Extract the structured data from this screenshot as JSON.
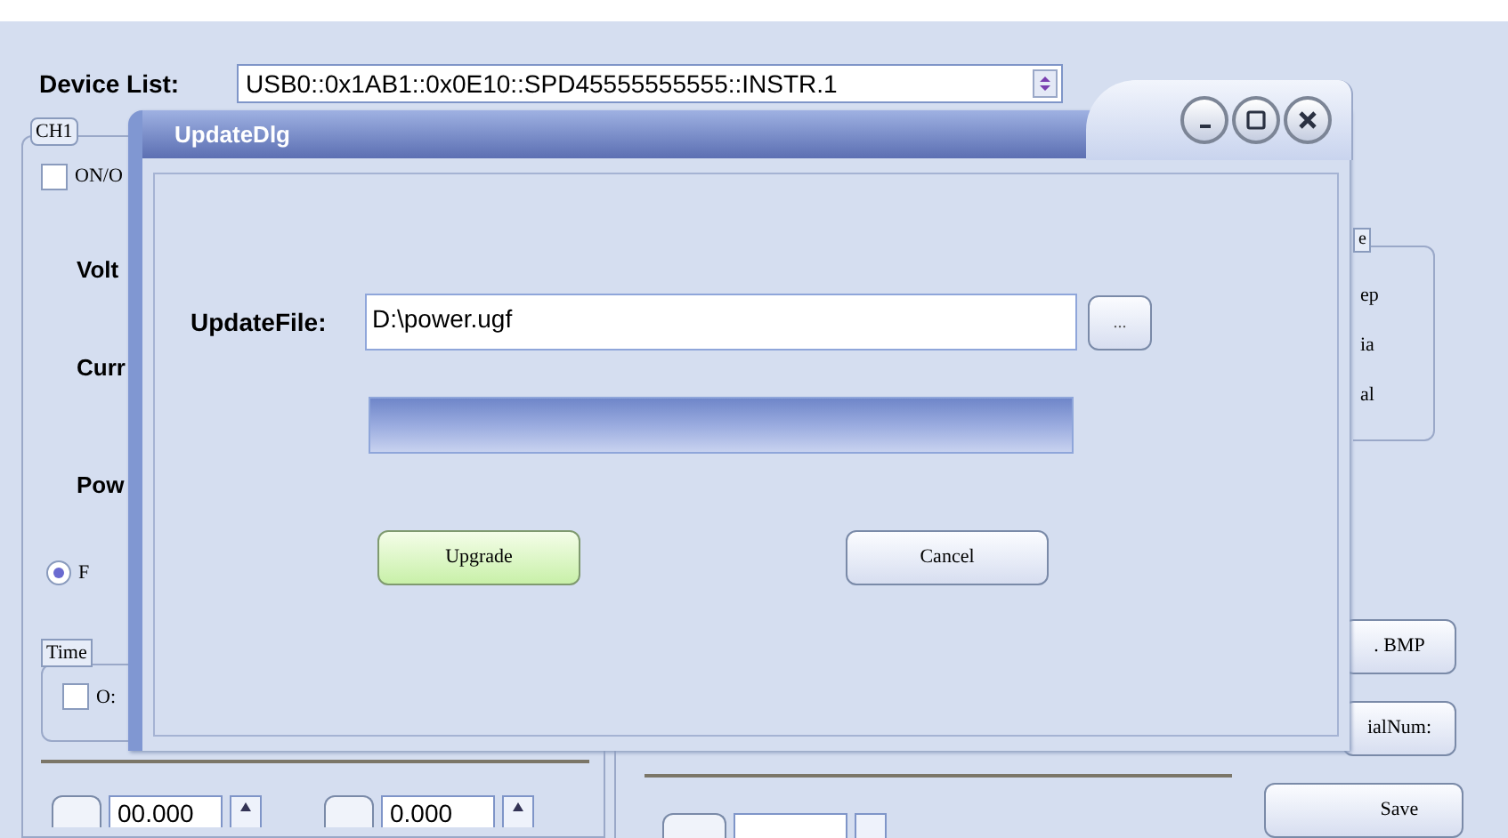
{
  "device_list": {
    "label": "Device List:",
    "value": "USB0::0x1AB1::0x0E10::SPD45555555555::INSTR.1"
  },
  "channel_panel": {
    "tab": "CH1",
    "output_checkbox": {
      "label": "ON/O",
      "checked": false
    },
    "labels": [
      "Volt",
      "Curr",
      "Pow"
    ],
    "mode_radio": {
      "label": "F",
      "selected": true
    },
    "timer_group": {
      "tab": "Time",
      "checkbox": {
        "label": "O:",
        "checked": false
      }
    },
    "spin_values": [
      "00.000",
      "0.000"
    ]
  },
  "right_group": {
    "tab": "e",
    "items": [
      "ep",
      "ia",
      "al"
    ]
  },
  "side_buttons": [
    ". BMP",
    "ialNum:",
    "Save"
  ],
  "dialog": {
    "title": "UpdateDlg",
    "file_label": "UpdateFile:",
    "file_value": "D:\\power.ugf",
    "browse_button": "...",
    "progress": {
      "level": 1
    },
    "buttons": [
      {
        "label": "Upgrade",
        "kind": "default"
      },
      {
        "label": "Cancel",
        "kind": "normal"
      }
    ]
  }
}
